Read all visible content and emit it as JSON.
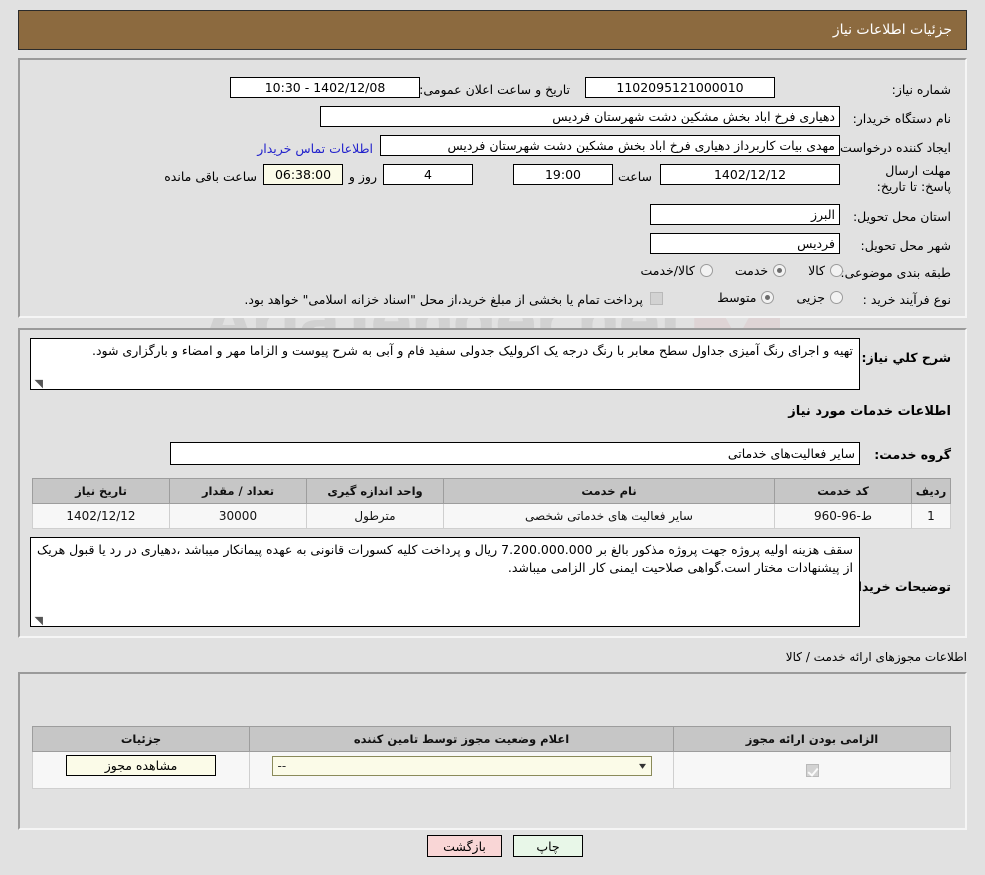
{
  "header": {
    "title": "جزئیات اطلاعات نیاز"
  },
  "form": {
    "need_number_label": "شماره نیاز:",
    "need_number_value": "1102095121000010",
    "announce_label": "تاریخ و ساعت اعلان عمومی:",
    "announce_value": "1402/12/08 - 10:30",
    "buyer_org_label": "نام دستگاه خریدار:",
    "buyer_org_value": "دهیاری فرخ اباد بخش مشکین دشت شهرستان فردیس",
    "requester_label": "ایجاد کننده درخواست:",
    "requester_value": "مهدی بیات کاربرداز دهیاری فرخ اباد بخش مشکین دشت شهرستان فردیس",
    "buyer_contact_link": "اطلاعات تماس خریدار",
    "deadline_label": "مهلت ارسال پاسخ: تا تاریخ:",
    "deadline_date": "1402/12/12",
    "deadline_time_label": "ساعت",
    "deadline_time": "19:00",
    "remaining_days": "4",
    "remaining_days_label": "روز و",
    "remaining_time": "06:38:00",
    "remaining_time_label": "ساعت باقی مانده",
    "province_label": "استان محل تحویل:",
    "province_value": "البرز",
    "city_label": "شهر محل تحویل:",
    "city_value": "فردیس",
    "category_label": "طبقه بندی موضوعی:",
    "category_options": [
      {
        "label": "کالا",
        "selected": false
      },
      {
        "label": "خدمت",
        "selected": true
      },
      {
        "label": "کالا/خدمت",
        "selected": false
      }
    ],
    "process_label": "نوع فرآیند خرید :",
    "process_options": [
      {
        "label": "جزیی",
        "selected": false
      },
      {
        "label": "متوسط",
        "selected": true
      }
    ],
    "treasury_checkbox_checked": false,
    "treasury_note": "پرداخت تمام یا بخشی از مبلغ خرید،از محل \"اسناد خزانه اسلامی\" خواهد بود."
  },
  "description": {
    "label": "شرح کلي نياز:",
    "text": "تهیه و اجرای رنگ آمیزی جداول سطح معابر با رنگ درجه یک اکرولیک جدولی سفید فام و آبی به شرح پیوست و الزاما مهر و امضاء و بارگزاری شود."
  },
  "services_section": {
    "heading": "اطلاعات خدمات مورد نیاز",
    "group_label": "گروه خدمت:",
    "group_value": "سایر فعالیت‌های خدماتی",
    "columns": [
      "ردیف",
      "کد خدمت",
      "نام خدمت",
      "واحد اندازه گیری",
      "تعداد / مقدار",
      "تاریخ نیاز"
    ],
    "rows": [
      {
        "row": "1",
        "code": "ط-96-960",
        "name": "سایر فعالیت های خدماتی شخصی",
        "unit": "مترطول",
        "quantity": "30000",
        "date": "1402/12/12"
      }
    ]
  },
  "buyer_notes": {
    "label": "توضیحات خریدار:",
    "text": "سقف هزینه اولیه پروژه جهت پروژه مذکور بالغ بر 7.200.000.000 ریال و پرداخت کلیه کسورات قانونی به عهده پیمانکار میباشد ،دهیاری  در رد یا قبول هریک از پیشنهادات مختار است.گواهی صلاحیت ایمنی کار الزامی میباشد."
  },
  "permits_section": {
    "caption": "اطلاعات مجوزهای ارائه خدمت / کالا",
    "columns": [
      "الزامی بودن ارائه مجوز",
      "اعلام وضعیت مجوز توسط تامین کننده",
      "جزئیات"
    ],
    "rows": [
      {
        "required_checked": true,
        "status_value": "--",
        "detail_button": "مشاهده مجوز"
      }
    ]
  },
  "footer": {
    "print_label": "چاپ",
    "back_label": "بازگشت"
  },
  "watermark": {
    "text": "AriaTender.net"
  },
  "colors": {
    "header_bg": "#8c6a3f",
    "page_bg": "#e1e1e1",
    "link": "#2222cc",
    "print_btn": "#e8f7e8",
    "back_btn": "#f9d6d6",
    "cream_field": "#fbfbe8"
  }
}
